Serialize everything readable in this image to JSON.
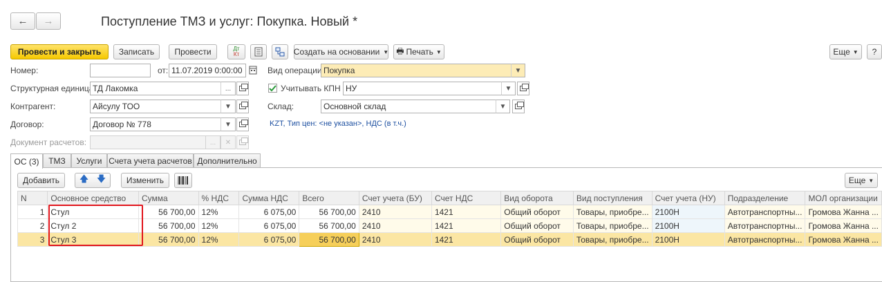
{
  "title": "Поступление ТМЗ и услуг: Покупка. Новый *",
  "nav": {
    "back": "←",
    "forward": "→"
  },
  "toolbar": {
    "post_close": "Провести и закрыть",
    "save": "Записать",
    "post": "Провести",
    "dt_kt_top": "Дт",
    "dt_kt_bottom": "Кт",
    "create_based": "Создать на основании",
    "print": "Печать",
    "more": "Еще",
    "help": "?"
  },
  "form": {
    "number_label": "Номер:",
    "number_value": "",
    "date_label": "от:",
    "date_value": "11.07.2019  0:00:00",
    "unit_label": "Структурная единица:",
    "unit_value": "ТД Лакомка",
    "contractor_label": "Контрагент:",
    "contractor_value": "Айсулу ТОО",
    "contract_label": "Договор:",
    "contract_value": "Договор № 778",
    "settlement_doc_label": "Документ расчетов:",
    "settlement_doc_value": "",
    "operation_label": "Вид операции:",
    "operation_value": "Покупка",
    "kpn_label": "Учитывать КПН",
    "kpn_checked": true,
    "kpn_value": "НУ",
    "warehouse_label": "Склад:",
    "warehouse_value": "Основной склад",
    "price_info": "KZT, Тип цен: <не указан>, НДС (в т.ч.)"
  },
  "tabs": [
    {
      "label": "ОС (3)",
      "active": true
    },
    {
      "label": "ТМЗ",
      "active": false
    },
    {
      "label": "Услуги",
      "active": false
    },
    {
      "label": "Счета учета расчетов",
      "active": false
    },
    {
      "label": "Дополнительно",
      "active": false
    }
  ],
  "table_toolbar": {
    "add": "Добавить",
    "edit": "Изменить",
    "more": "Еще"
  },
  "table": {
    "columns": [
      "N",
      "Основное средство",
      "Сумма",
      "% НДС",
      "Сумма НДС",
      "Всего",
      "Счет учета (БУ)",
      "Счет НДС",
      "Вид оборота",
      "Вид поступления",
      "Счет учета (НУ)",
      "Подразделение",
      "МОЛ организации"
    ],
    "rows": [
      [
        "1",
        "Стул",
        "56 700,00",
        "12%",
        "6 075,00",
        "56 700,00",
        "2410",
        "1421",
        "Общий оборот",
        "Товары, приобре...",
        "2100Н",
        "Автотранспортны...",
        "Громова Жанна ..."
      ],
      [
        "2",
        "Стул 2",
        "56 700,00",
        "12%",
        "6 075,00",
        "56 700,00",
        "2410",
        "1421",
        "Общий оборот",
        "Товары, приобре...",
        "2100Н",
        "Автотранспортны...",
        "Громова Жанна ..."
      ],
      [
        "3",
        "Стул 3",
        "56 700,00",
        "12%",
        "6 075,00",
        "56 700,00",
        "2410",
        "1421",
        "Общий оборот",
        "Товары, приобре...",
        "2100Н",
        "Автотранспортны...",
        "Громова Жанна ..."
      ]
    ],
    "selected_row": 2
  },
  "colors": {
    "primary_button": "#f6c900",
    "highlight_box": "#e1141b",
    "link": "#1c4fa0",
    "selected_row": "#fbe6a3"
  }
}
